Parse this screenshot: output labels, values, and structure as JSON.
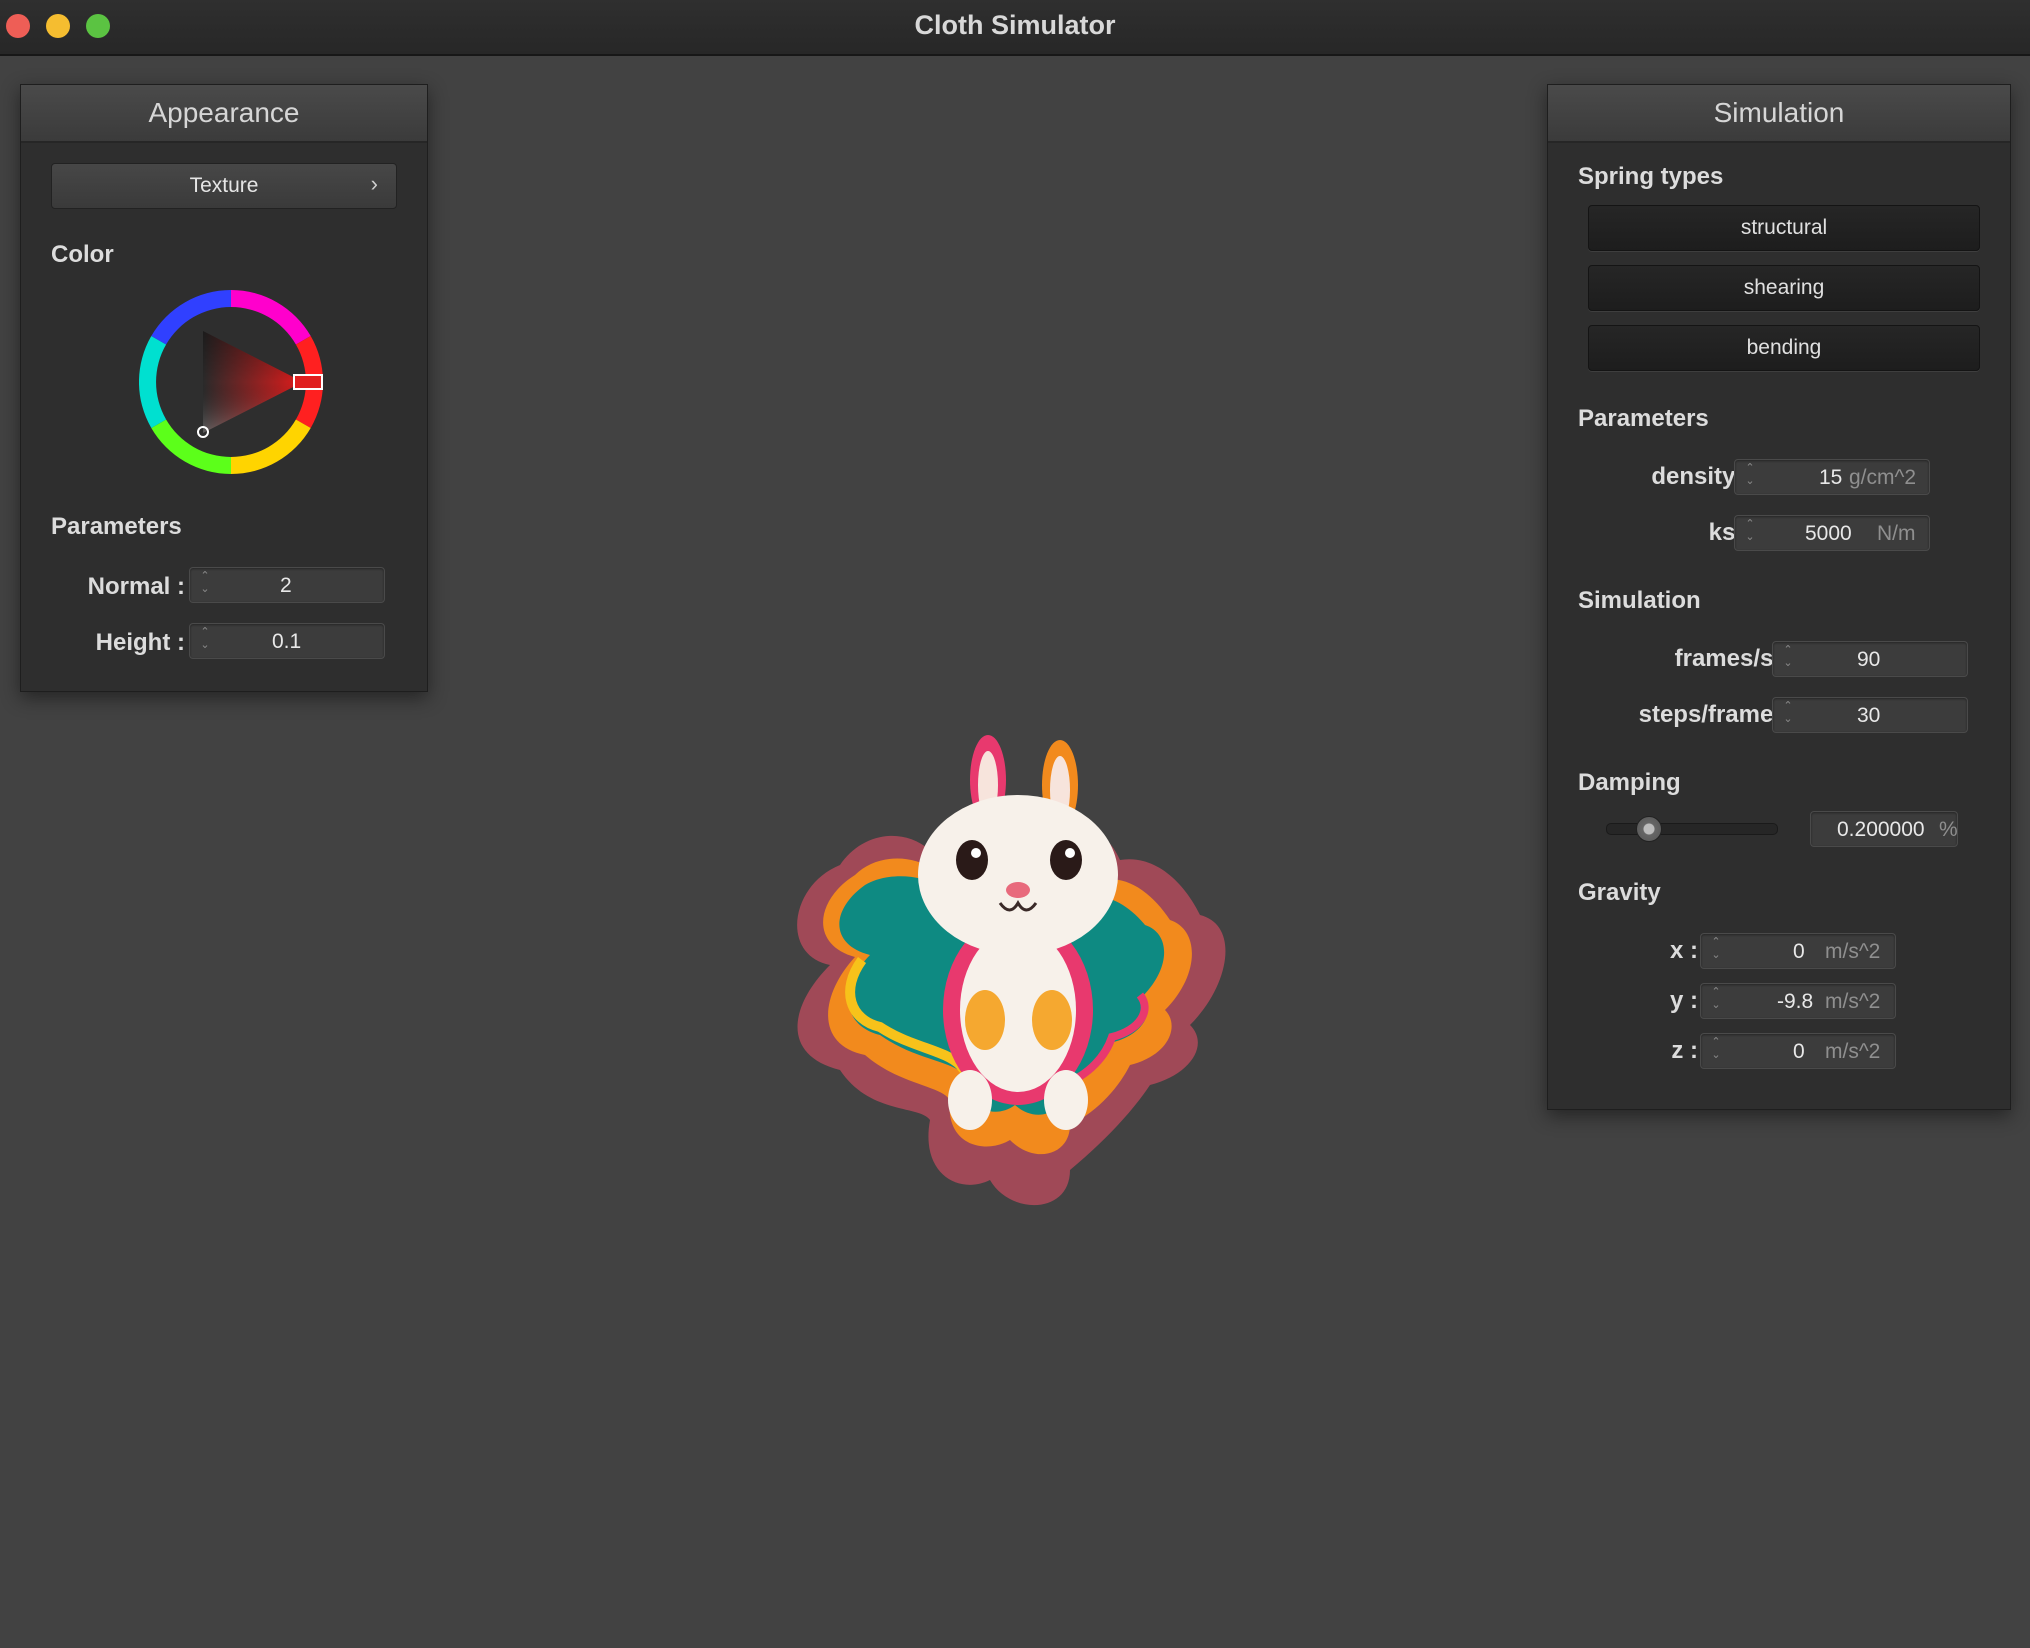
{
  "window": {
    "title": "Cloth Simulator"
  },
  "appearance": {
    "header": "Appearance",
    "texture_button": "Texture",
    "color_label": "Color",
    "selected_color": "#e02020",
    "parameters_label": "Parameters",
    "normal": {
      "label": "Normal :",
      "value": "2"
    },
    "height": {
      "label": "Height :",
      "value": "0.1"
    }
  },
  "simulation": {
    "header": "Simulation",
    "spring_types_label": "Spring types",
    "spring_types": [
      "structural",
      "shearing",
      "bending"
    ],
    "parameters_label": "Parameters",
    "density": {
      "label": "density :",
      "value": "15",
      "unit": "g/cm^2"
    },
    "ks": {
      "label": "ks :",
      "value": "5000",
      "unit": "N/m"
    },
    "simulation_label": "Simulation",
    "frames": {
      "label": "frames/s :",
      "value": "90"
    },
    "steps": {
      "label": "steps/frame :",
      "value": "30"
    },
    "damping_label": "Damping",
    "damping": {
      "value": "0.200000",
      "unit": "%",
      "fraction": 0.2
    },
    "gravity_label": "Gravity",
    "gravity": {
      "x": {
        "label": "x :",
        "value": "0",
        "unit": "m/s^2"
      },
      "y": {
        "label": "y :",
        "value": "-9.8",
        "unit": "m/s^2"
      },
      "z": {
        "label": "z :",
        "value": "0",
        "unit": "m/s^2"
      }
    }
  },
  "colors": {
    "background": "#424242",
    "panel": "#2e2e2e",
    "cloth_teal": "#0e8a82",
    "cloth_pink": "#e8396e",
    "cloth_orange": "#f28a1d"
  }
}
